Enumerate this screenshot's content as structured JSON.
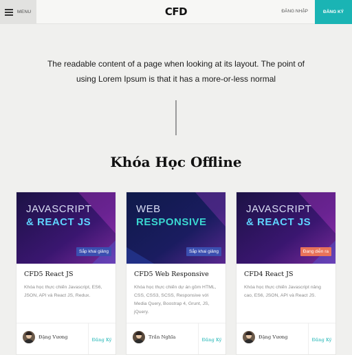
{
  "header": {
    "menu_label": "MENU",
    "logo": "CFD",
    "login_label": "ĐĂNG NHẬP",
    "register_label": "ĐĂNG KÝ"
  },
  "intro": {
    "text": "The readable content of a page when looking at its layout. The point of using Lorem Ipsum is that it has a more-or-less normal"
  },
  "section": {
    "title": "Khóa Học Offline"
  },
  "colors": {
    "accent": "#1ab4b4",
    "badge_upcoming": "#3b4fb0",
    "badge_ongoing": "#e8735a"
  },
  "courses": [
    {
      "thumb_line1": "JAVASCRIPT",
      "thumb_line2": "& REACT JS",
      "badge": "Sắp khai giảng",
      "title": "CFD5 React JS",
      "description": "Khóa học thực chiến Javascript, ES6, JSON, API và React JS, Redux.",
      "author": "Đặng Vương",
      "enroll_label": "Đăng Ký"
    },
    {
      "thumb_line1": "WEB",
      "thumb_line2": "RESPONSIVE",
      "badge": "Sắp khai giảng",
      "title": "CFD5 Web Responsive",
      "description": "Khóa học thực chiến dự án gồm HTML, CSS, CSS3, SCSS, Responsive với Media Query, Boostrap 4, Grunt, JS, jQuery.",
      "author": "Trần Nghĩa",
      "enroll_label": "Đăng Ký"
    },
    {
      "thumb_line1": "JAVASCRIPT",
      "thumb_line2": "& REACT JS",
      "badge": "Đang diễn ra",
      "title": "CFD4 React JS",
      "description": "Khóa học thực chiến Javascript nâng cao, ES6, JSON, API và React JS.",
      "author": "Đặng Vương",
      "enroll_label": "Đăng Ký"
    }
  ]
}
